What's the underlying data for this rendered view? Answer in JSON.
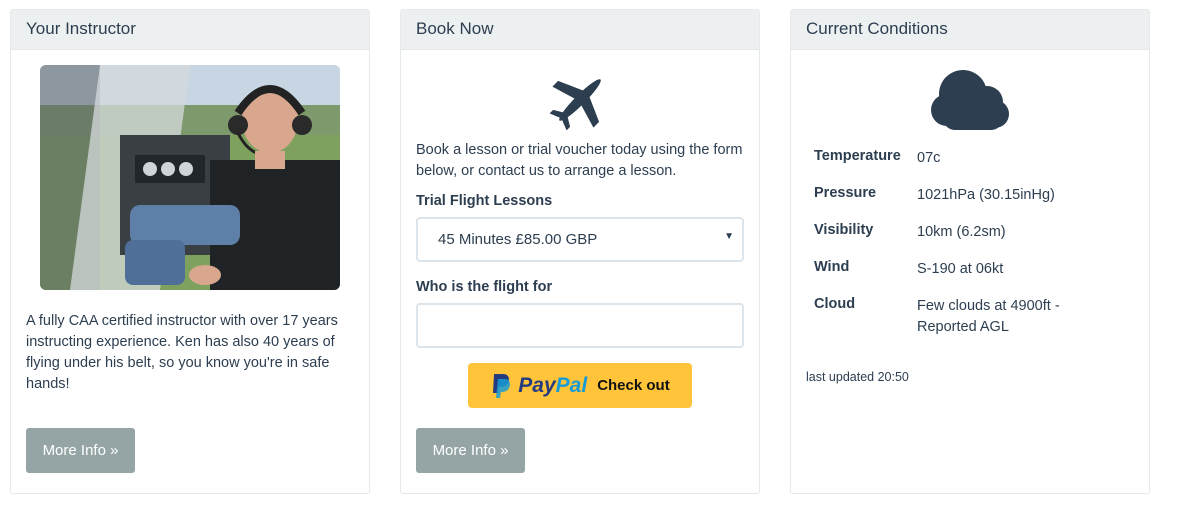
{
  "instructor": {
    "heading": "Your Instructor",
    "description": "A fully CAA certified instructor with over 17 years instructing experience. Ken has also 40 years of flying under his belt, so you know you're in safe hands!",
    "more_button": "More Info »",
    "photo_icon": "instructor-photo"
  },
  "booking": {
    "heading": "Book Now",
    "icon": "plane-icon",
    "intro": "Book a lesson or trial voucher today using the form below, or contact us to arrange a lesson.",
    "lessons_label": "Trial Flight Lessons",
    "lessons_selected": "45 Minutes £85.00 GBP",
    "who_label": "Who is the flight for",
    "who_value": "",
    "paypal": {
      "pay": "Pay",
      "pal": "Pal",
      "checkout": "Check out"
    },
    "more_button": "More Info »",
    "colors": {
      "paypal_button": "#ffc439",
      "paypal_dark": "#253b80",
      "paypal_light": "#179bd7"
    }
  },
  "conditions": {
    "heading": "Current Conditions",
    "icon": "cloud-icon",
    "rows": [
      {
        "key": "Temperature",
        "value": "07c"
      },
      {
        "key": "Pressure",
        "value": "1021hPa (30.15inHg)"
      },
      {
        "key": "Visibility",
        "value": "10km (6.2sm)"
      },
      {
        "key": "Wind",
        "value": "S-190 at 06kt"
      },
      {
        "key": "Cloud",
        "value": "Few clouds at 4900ft - Reported AGL"
      }
    ],
    "updated": "last updated 20:50"
  },
  "colors": {
    "text": "#2c3e50",
    "heading_bg": "#ecf0f1",
    "button": "#95a5a6"
  }
}
